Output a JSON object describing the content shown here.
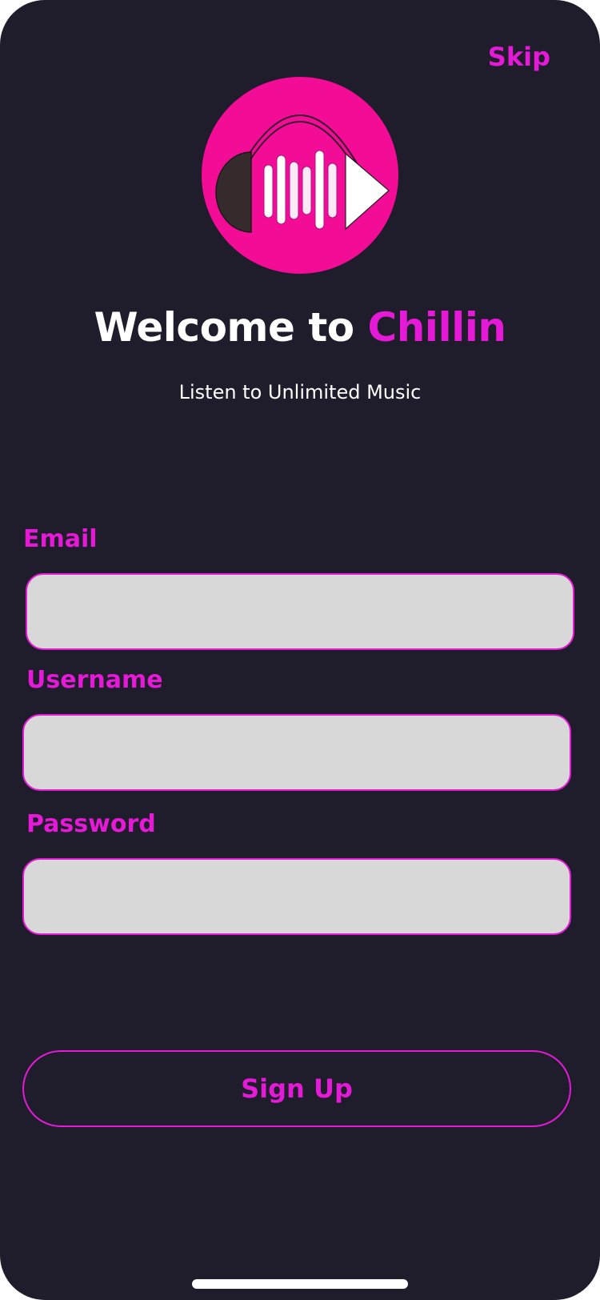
{
  "header": {
    "skip_label": "Skip"
  },
  "welcome": {
    "title_prefix": "Welcome to ",
    "title_brand": "Chillin",
    "subtitle": "Listen to Unlimited Music"
  },
  "form": {
    "email_label": "Email",
    "email_value": "",
    "username_label": "Username",
    "username_value": "",
    "password_label": "Password",
    "password_value": "",
    "submit_label": "Sign Up"
  },
  "icons": {
    "logo": "headphones-music-play-icon"
  },
  "colors": {
    "background": "#1f1c2b",
    "accent": "#e41ad6",
    "logo_circle": "#f20c96",
    "field_fill": "#d8d8d8",
    "text": "#ffffff"
  }
}
